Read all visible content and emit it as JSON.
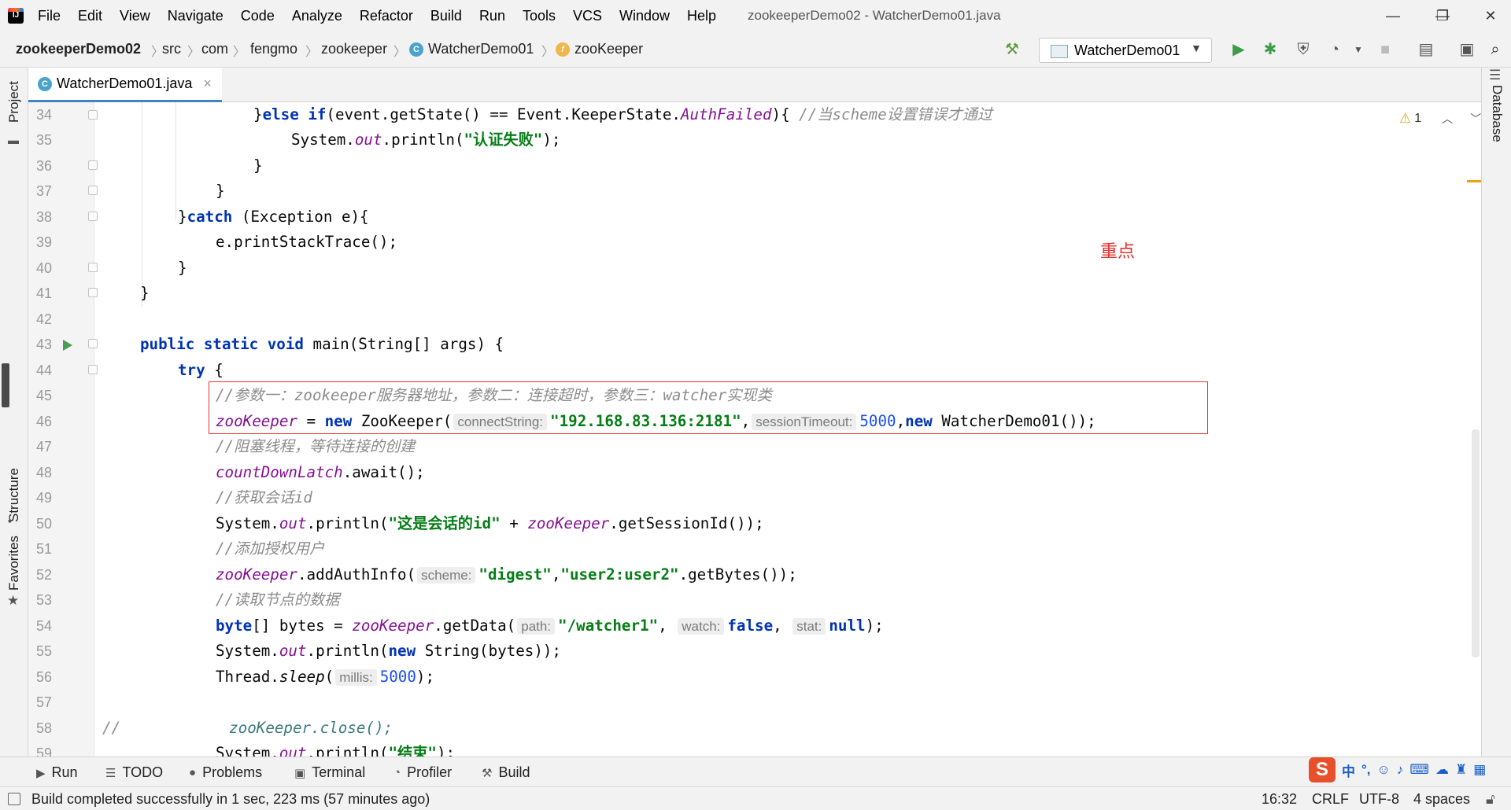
{
  "window": {
    "title": "zookeeperDemo02 - WatcherDemo01.java",
    "minimize": "—",
    "maximize": "❐",
    "close": "✕"
  },
  "menu": [
    "File",
    "Edit",
    "View",
    "Navigate",
    "Code",
    "Analyze",
    "Refactor",
    "Build",
    "Run",
    "Tools",
    "VCS",
    "Window",
    "Help"
  ],
  "breadcrumb": {
    "project": "zookeeperDemo02",
    "parts": [
      "src",
      "com",
      "fengmo",
      "zookeeper"
    ],
    "class": "WatcherDemo01",
    "member": "zooKeeper"
  },
  "run_config": "WatcherDemo01",
  "tab": {
    "label": "WatcherDemo01.java",
    "close": "×"
  },
  "left_tools": {
    "project": "Project",
    "structure": "Structure",
    "favorites": "Favorites"
  },
  "right_tools": {
    "database": "Database"
  },
  "editor": {
    "warning_count": "1",
    "annotation": "重点"
  },
  "code": {
    "l34": {
      "n": "34",
      "a": "}",
      "b": "else",
      "c": " ",
      "d": "if",
      "e": "(event.getState() == Event.KeeperState.",
      "f": "AuthFailed",
      "g": "){ ",
      "h": "//当scheme设置错误才通过"
    },
    "l35": {
      "n": "35",
      "a": "System.",
      "b": "out",
      "c": ".println(",
      "d": "\"认证失败\"",
      "e": ");"
    },
    "l36": {
      "n": "36",
      "a": "}"
    },
    "l37": {
      "n": "37",
      "a": "}"
    },
    "l38": {
      "n": "38",
      "a": "}",
      "b": "catch",
      "c": " (Exception e){"
    },
    "l39": {
      "n": "39",
      "a": "e.printStackTrace();"
    },
    "l40": {
      "n": "40",
      "a": "}"
    },
    "l41": {
      "n": "41",
      "a": "}"
    },
    "l42": {
      "n": "42"
    },
    "l43": {
      "n": "43",
      "a": "public",
      "b": "static",
      "c": "void",
      "d": " main(String[] args) {"
    },
    "l44": {
      "n": "44",
      "a": "try",
      "b": " {"
    },
    "l45": {
      "n": "45",
      "a": "//参数一：zookeeper服务器地址，参数二：连接超时，参数三：watcher实现类"
    },
    "l46": {
      "n": "46",
      "a": "zooKeeper",
      "b": " = ",
      "c": "new",
      "d": " ZooKeeper(",
      "h1": "connectString:",
      "e": "\"192.168.83.136:2181\"",
      ",": ",",
      "h2": "sessionTimeout:",
      "f": "5000",
      "g": ",",
      "h": "new",
      "i": " WatcherDemo01());"
    },
    "l47": {
      "n": "47",
      "a": "//阻塞线程，等待连接的创建"
    },
    "l48": {
      "n": "48",
      "a": "countDownLatch",
      "b": ".await();"
    },
    "l49": {
      "n": "49",
      "a": "//获取会话id"
    },
    "l50": {
      "n": "50",
      "a": "System.",
      "b": "out",
      "c": ".println(",
      "d": "\"这是会话的id\"",
      "e": " + ",
      "f": "zooKeeper",
      "g": ".getSessionId());"
    },
    "l51": {
      "n": "51",
      "a": "//添加授权用户"
    },
    "l52": {
      "n": "52",
      "a": "zooKeeper",
      "b": ".addAuthInfo(",
      "h1": "scheme:",
      "c": "\"digest\"",
      "d": ",",
      "e": "\"user2:user2\"",
      "f": ".getBytes());"
    },
    "l53": {
      "n": "53",
      "a": "//读取节点的数据"
    },
    "l54": {
      "n": "54",
      "a": "byte",
      "b": "[] bytes = ",
      "c": "zooKeeper",
      "d": ".getData(",
      "h1": "path:",
      "e": "\"/watcher1\"",
      "f": ", ",
      "h2": "watch:",
      "g": "false",
      "h": ", ",
      "h3": "stat:",
      "i": "null",
      "j": ");"
    },
    "l55": {
      "n": "55",
      "a": "System.",
      "b": "out",
      "c": ".println(",
      "d": "new",
      "e": " String(bytes));"
    },
    "l56": {
      "n": "56",
      "a": "Thread.",
      "b": "sleep",
      "c": "(",
      "h1": "millis:",
      "d": "5000",
      "e": ");"
    },
    "l57": {
      "n": "57"
    },
    "l58": {
      "n": "58",
      "a": "//",
      "b": "zooKeeper.close();"
    },
    "l59": {
      "n": "59",
      "a": "System.",
      "b": "out",
      "c": ".println(",
      "d": "\"结束\"",
      "e": ");"
    }
  },
  "tool_windows": [
    "Run",
    "TODO",
    "Problems",
    "Terminal",
    "Profiler",
    "Build"
  ],
  "status": {
    "message": "Build completed successfully in 1 sec, 223 ms (57 minutes ago)",
    "position": "16:32",
    "line_sep": "CRLF",
    "encoding": "UTF-8",
    "indent": "4 spaces"
  },
  "ime": {
    "logo": "S",
    "lang": "中"
  }
}
